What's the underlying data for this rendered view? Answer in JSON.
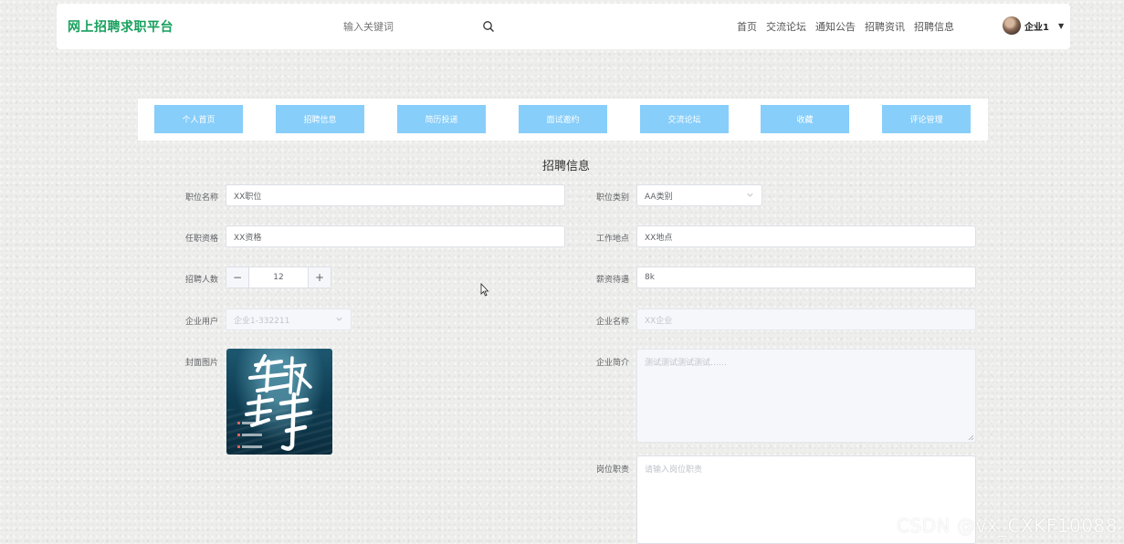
{
  "header": {
    "logo": "网上招聘求职平台",
    "search_placeholder": "输入关键词",
    "nav": [
      "首页",
      "交流论坛",
      "通知公告",
      "招聘资讯",
      "招聘信息"
    ],
    "user_name": "企业1"
  },
  "tabs": [
    "个人首页",
    "招聘信息",
    "简历投递",
    "面试邀约",
    "交流论坛",
    "收藏",
    "评论管理"
  ],
  "form": {
    "title": "招聘信息",
    "job_name": {
      "label": "职位名称",
      "value": "XX职位"
    },
    "job_type": {
      "label": "职位类别",
      "value": "AA类别"
    },
    "qualification": {
      "label": "任职资格",
      "value": "XX资格"
    },
    "work_location": {
      "label": "工作地点",
      "value": "XX地点"
    },
    "headcount": {
      "label": "招聘人数",
      "value": "12"
    },
    "salary": {
      "label": "薪资待遇",
      "value": "8k"
    },
    "company_user": {
      "label": "企业用户",
      "value": "企业1-332211"
    },
    "company_name": {
      "label": "企业名称",
      "value": "XX企业"
    },
    "cover": {
      "label": "封面图片"
    },
    "company_intro": {
      "label": "企业简介",
      "value": "测试测试测试测试……"
    },
    "job_duty": {
      "label": "岗位职责",
      "placeholder": "请输入岗位职责"
    }
  },
  "watermark": "CSDN @vx_CXKF10088",
  "colors": {
    "brand": "#18a05e",
    "tab": "#87cefa"
  }
}
